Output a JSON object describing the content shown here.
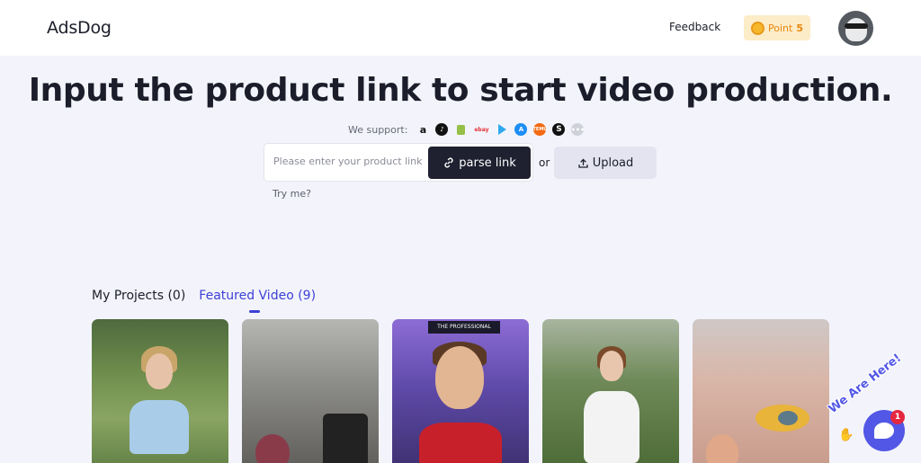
{
  "header": {
    "logo": "AdsDog",
    "feedback_label": "Feedback",
    "points_label": "Point",
    "points_value": "5"
  },
  "hero": {
    "title": "Input the product link to start video production."
  },
  "support": {
    "label": "We support:",
    "platforms": [
      "amazon-icon",
      "tiktok-icon",
      "shopify-icon",
      "ebay-icon",
      "google-play-icon",
      "app-store-icon",
      "temu-icon",
      "shein-icon",
      "more-icon"
    ]
  },
  "link_form": {
    "placeholder": "Please enter your product link",
    "value": "",
    "parse_label": "parse link",
    "or_label": "or",
    "upload_label": "Upload",
    "try_me_label": "Try me?"
  },
  "tabs": [
    {
      "label": "My Projects (0)",
      "active": false
    },
    {
      "label": "Featured Video (9)",
      "active": true
    }
  ],
  "cards": [
    {
      "id": "video-1"
    },
    {
      "id": "video-2"
    },
    {
      "id": "video-3",
      "banner": "THE PROFESSIONAL"
    },
    {
      "id": "video-4"
    },
    {
      "id": "video-5"
    }
  ],
  "chat": {
    "tagline": "We Are Here!",
    "badge_count": "1"
  },
  "colors": {
    "accent": "#3d40d6",
    "dark_button": "#1f2030",
    "points_bg": "#fdecc8",
    "points_text": "#e7870f",
    "chat": "#5257e6"
  }
}
